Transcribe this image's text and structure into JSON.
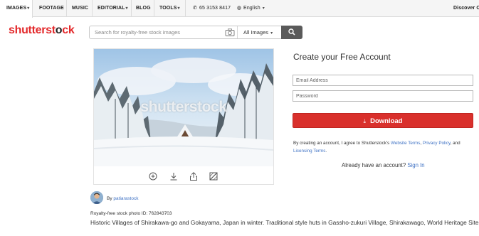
{
  "nav": {
    "images": "IMAGES",
    "footage": "FOOTAGE",
    "music": "MUSIC",
    "editorial": "EDITORIAL",
    "blog": "BLOG",
    "tools": "TOOLS",
    "phone": "65 3153 8417",
    "language": "English",
    "discover": "Discover C"
  },
  "logo": {
    "part1": "shutterst",
    "part2": "o",
    "part3": "ck"
  },
  "search": {
    "placeholder": "Search for royalty-free stock images",
    "value": "",
    "category": "All Images"
  },
  "photo": {
    "watermark": "shutterstock",
    "icons": [
      "zoom-icon",
      "download-icon",
      "share-icon",
      "edit-icon"
    ]
  },
  "contributor": {
    "by": "By",
    "name": "patiarastock"
  },
  "photo_id": "Royalty-free stock photo ID: 762843703",
  "caption": "Historic Villages of Shirakawa-go and Gokayama, Japan in winter. Traditional style huts in Gassho-zukuri Village, Shirakawago, World Heritage Site.",
  "account": {
    "title": "Create your Free Account",
    "email_placeholder": "Email Address",
    "password_placeholder": "Password",
    "download_label": "Download",
    "terms_prefix": "By creating an account, I agree to Shutterstock's",
    "website_terms": "Website Terms",
    "privacy_policy": "Privacy Policy",
    "and": ", and",
    "licensing_terms": "Licensing Terms",
    "have_account": "Already have an account?",
    "sign_in": "Sign In"
  },
  "colors": {
    "brand_red": "#e3292b",
    "button_red": "#d9302c",
    "link_blue": "#3f72c4"
  }
}
